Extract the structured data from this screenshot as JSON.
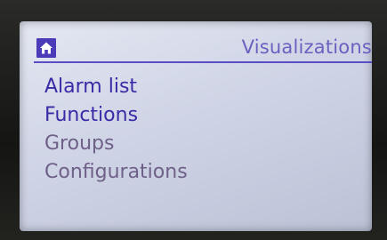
{
  "header": {
    "home_icon": "home-icon",
    "title": "Visualizations"
  },
  "colors": {
    "accent": "#4b3bb8",
    "title": "#6b5fbf",
    "selected_text": "#3b2aa6",
    "item_text": "#6f6088",
    "screen_bg": "#d6dbea"
  },
  "menu": {
    "items": [
      {
        "label": "Alarm list",
        "selected": true
      },
      {
        "label": "Functions",
        "selected": true
      },
      {
        "label": "Groups",
        "selected": false
      },
      {
        "label": "Configurations",
        "selected": false
      }
    ]
  }
}
